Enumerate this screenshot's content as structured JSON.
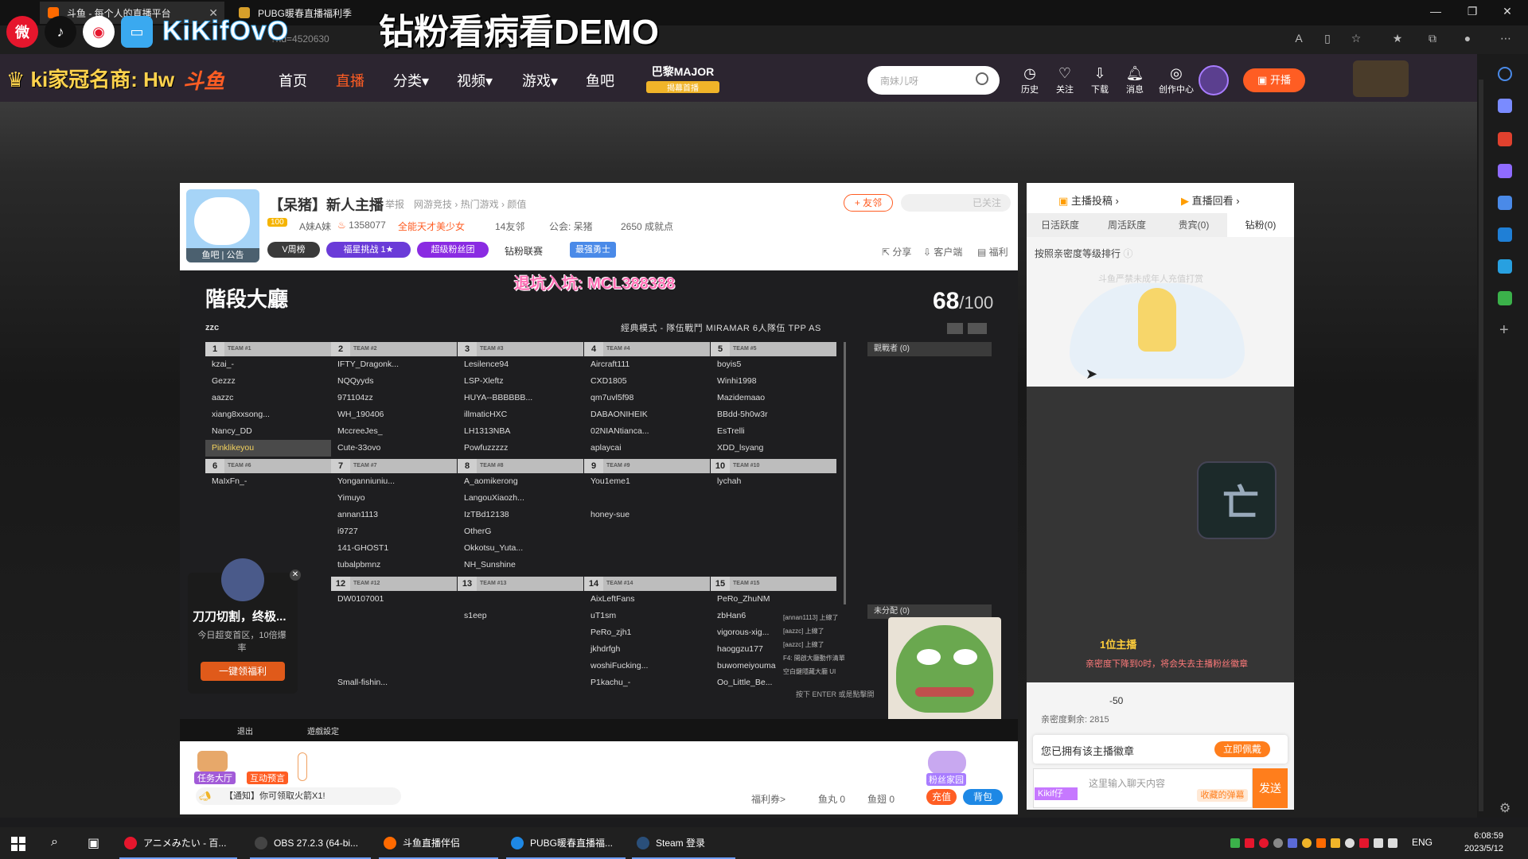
{
  "browser": {
    "tabs": [
      {
        "label": "斗鱼 - 每个人的直播平台"
      },
      {
        "label": "PUBG暖春直播福利季"
      }
    ],
    "url": "?rid=4520630"
  },
  "overlay": {
    "streamer_name": "KiKifOvO",
    "title": "钻粉看病看DEMO",
    "recruit": "退坑入坑: MCL388388"
  },
  "nav": {
    "crown_text": "ki家冠名商: Hw",
    "brand": "斗鱼",
    "items": [
      "首页",
      "直播",
      "分类",
      "视频",
      "游戏",
      "鱼吧"
    ],
    "active_index": 1,
    "major_label": "巴黎MAJOR",
    "major_sub": "揭幕首播",
    "search_placeholder": "南妹儿呀",
    "tools": [
      "历史",
      "关注",
      "下载",
      "消息",
      "创作中心"
    ],
    "live_button": "开播"
  },
  "room": {
    "title": "【呆猪】新人主播",
    "report": "举报",
    "categories": "网游竞技 › 热门游戏 › 颜值",
    "level": "100",
    "anchor_name": "A妹A妹",
    "hot": "1358077",
    "tag": "全能天才美少女",
    "friends": "14友邻",
    "guild": "公会: 呆猪",
    "achievements": "2650 成就点",
    "avatar_caption": "鱼吧 | 公告",
    "follow_button": "+ 友邻",
    "followed_button": "已关注",
    "pills": [
      "V周榜",
      "福星挑战 1★",
      "超级粉丝团",
      "钻粉联赛",
      "最强勇士"
    ],
    "actions": [
      "分享",
      "客户端",
      "福利"
    ]
  },
  "game": {
    "lobby_title": "階段大廳",
    "lobby_code": "zzc",
    "count": "68",
    "count_max": "/100",
    "mode": "經典模式 - 隊伍戰鬥   MIRAMAR   6人隊伍   TPP   AS",
    "observers": "觀戰者 (0)",
    "unassigned": "未分配 (0)",
    "bottom_left": "退出",
    "bottom_mid": "遊戲設定",
    "teams": [
      {
        "num": "1",
        "tag": "TEAM #1",
        "players": [
          "kzai_-",
          "Gezzz",
          "aazzc",
          "xiang8xxsong...",
          "Nancy_DD",
          "Pinklikeyou"
        ]
      },
      {
        "num": "2",
        "tag": "TEAM #2",
        "players": [
          "IFTY_Dragonk...",
          "NQQyyds",
          "971104zz",
          "WH_190406",
          "MccreeJes_",
          "Cute-33ovo"
        ]
      },
      {
        "num": "3",
        "tag": "TEAM #3",
        "players": [
          "Lesilence94",
          "LSP-Xleftz",
          "HUYA--BBBBBB...",
          "illmaticHXC",
          "LH1313NBA",
          "Powfuzzzzz"
        ]
      },
      {
        "num": "4",
        "tag": "TEAM #4",
        "players": [
          "Aircraft111",
          "CXD1805",
          "qm7uvl5f98",
          "DABAONIHEIK",
          "02NIANtianca...",
          "aplaycai"
        ]
      },
      {
        "num": "5",
        "tag": "TEAM #5",
        "players": [
          "boyis5",
          "Winhi1998",
          "Mazidemaao",
          "BBdd-5h0w3r",
          "EsTrelli",
          "XDD_lsyang"
        ]
      },
      {
        "num": "6",
        "tag": "TEAM #6",
        "players": [
          "MaIxFn_-"
        ]
      },
      {
        "num": "7",
        "tag": "TEAM #7",
        "players": [
          "Yonganniuniu...",
          "Yimuyo",
          "annan1113",
          "i9727",
          "141-GHOST1",
          "tubalpbmnz"
        ]
      },
      {
        "num": "8",
        "tag": "TEAM #8",
        "players": [
          "A_aomikerong",
          "LangouXiaozh...",
          "IzTBd12138",
          "OtherG",
          "Okkotsu_Yuta...",
          "NH_Sunshine"
        ]
      },
      {
        "num": "9",
        "tag": "TEAM #9",
        "players": [
          "You1eme1",
          "",
          "honey-sue"
        ]
      },
      {
        "num": "10",
        "tag": "TEAM #10",
        "players": [
          "lychah"
        ]
      },
      {
        "num": "12",
        "tag": "TEAM #12",
        "players": [
          "DW0107001",
          "",
          "",
          "",
          "",
          "Small-fishin..."
        ]
      },
      {
        "num": "13",
        "tag": "TEAM #13",
        "players": [
          "",
          "s1eep"
        ]
      },
      {
        "num": "14",
        "tag": "TEAM #14",
        "players": [
          "AixLeftFans",
          "uT1sm",
          "PeRo_zjh1",
          "jkhdrfgh",
          "woshiFucking...",
          "P1kachu_-"
        ]
      },
      {
        "num": "15",
        "tag": "TEAM #15",
        "players": [
          "PeRo_ZhuNM",
          "zbHan6",
          "vigorous-xig...",
          "haoggzu177",
          "buwomeiyouma",
          "Oo_Little_Be..."
        ]
      }
    ],
    "chat_log": [
      "[annan1113] 上線了",
      "[aazzc] 上線了",
      "[aazzc] 上線了",
      "F4: 開啟大廳動作清單",
      "空白鍵隱藏大廳 UI"
    ],
    "chat_hint": "按下 ENTER 或是點擊開",
    "ad_title": "刀刀切割，终极...",
    "ad_sub": "今日超变首区，10倍爆率",
    "ad_button": "一键领福利"
  },
  "below": {
    "task_hall": "任务大厅",
    "predict": "互动预言",
    "notice": "【通知】你可领取火箭X1!",
    "fans_home": "粉丝家园",
    "welfare": "福利券>",
    "fish_ball": "鱼丸 0",
    "fish_fin": "鱼翅 0",
    "recharge": "充值",
    "backpack": "背包"
  },
  "right_panel": {
    "top_left": "主播投稿",
    "top_right": "直播回看",
    "tabs": [
      "日活跃度",
      "周活跃度",
      "贵宾(0)",
      "钻粉(0)"
    ],
    "active_tab": 3,
    "rank_line": "按照亲密度等级排行",
    "rank_note": "斗鱼严禁未成年人充值打赏",
    "fan_head": "1位主播",
    "fan_note": "亲密度下降到0时，将会失去主播粉丝徽章",
    "intimacy": "-50",
    "intimacy_left": "亲密度剩余: 2815",
    "badge_text": "您已拥有该主播徽章",
    "wear_button": "立即佩戴",
    "chat_tag": "Kikif仔",
    "chat_placeholder": "这里输入聊天内容",
    "bullet_button": "收藏的弹幕",
    "send_button": "发送"
  },
  "taskbar": {
    "apps": [
      "アニメみたい - 百...",
      "OBS 27.2.3 (64-bi...",
      "斗鱼直播伴侣",
      "PUBG暖春直播福...",
      "Steam 登录"
    ],
    "lang": "ENG",
    "time": "6:08:59",
    "date": "2023/5/12"
  }
}
